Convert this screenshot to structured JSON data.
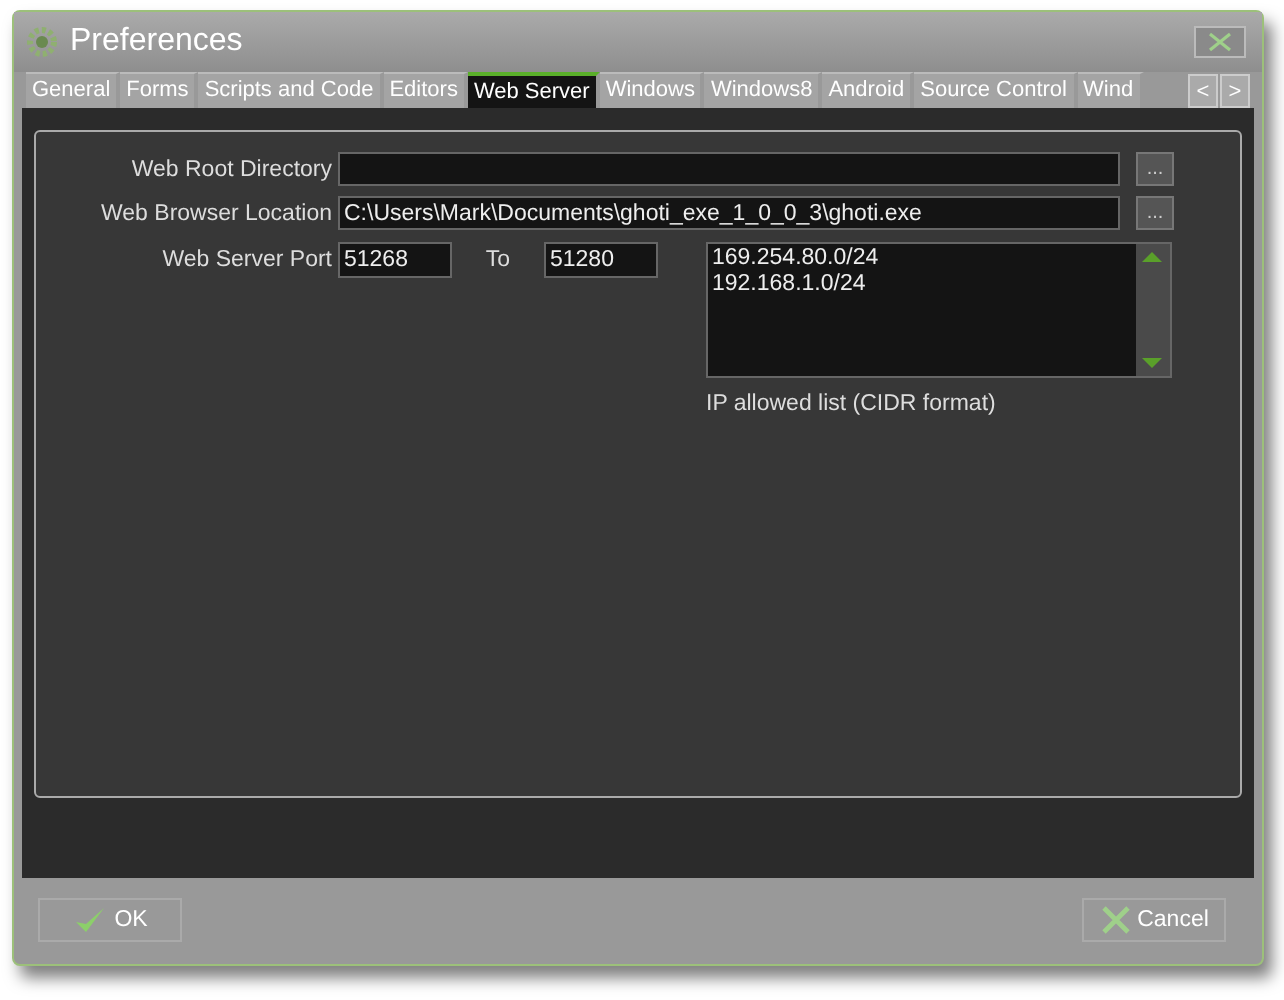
{
  "window": {
    "title": "Preferences"
  },
  "tabs": [
    {
      "label": "General",
      "selected": false
    },
    {
      "label": "Forms",
      "selected": false
    },
    {
      "label": "Scripts and Code",
      "selected": false
    },
    {
      "label": "Editors",
      "selected": false
    },
    {
      "label": "Web Server",
      "selected": true
    },
    {
      "label": "Windows",
      "selected": false
    },
    {
      "label": "Windows8",
      "selected": false
    },
    {
      "label": "Android",
      "selected": false
    },
    {
      "label": "Source Control",
      "selected": false
    },
    {
      "label": "Wind",
      "selected": false
    }
  ],
  "tab_scroll": [
    "<",
    ">"
  ],
  "fields": [
    {
      "label": "Web Root Directory",
      "browse": "..."
    },
    {
      "label": "Web Browser Location",
      "value": "C:\\Users\\Mark\\Documents\\ghoti_exe_1_0_0_3\\ghoti.exe",
      "browse": "..."
    }
  ],
  "port": {
    "label": "Web Server Port",
    "from": "51268",
    "to_label": "To",
    "to": "51280"
  },
  "ip_list": {
    "items": [
      "169.254.80.0/24",
      "192.168.1.0/24"
    ],
    "caption": "IP allowed list (CIDR format)"
  },
  "buttons": [
    {
      "kind": "ok",
      "label": "OK"
    },
    {
      "kind": "cancel",
      "label": "Cancel"
    }
  ]
}
